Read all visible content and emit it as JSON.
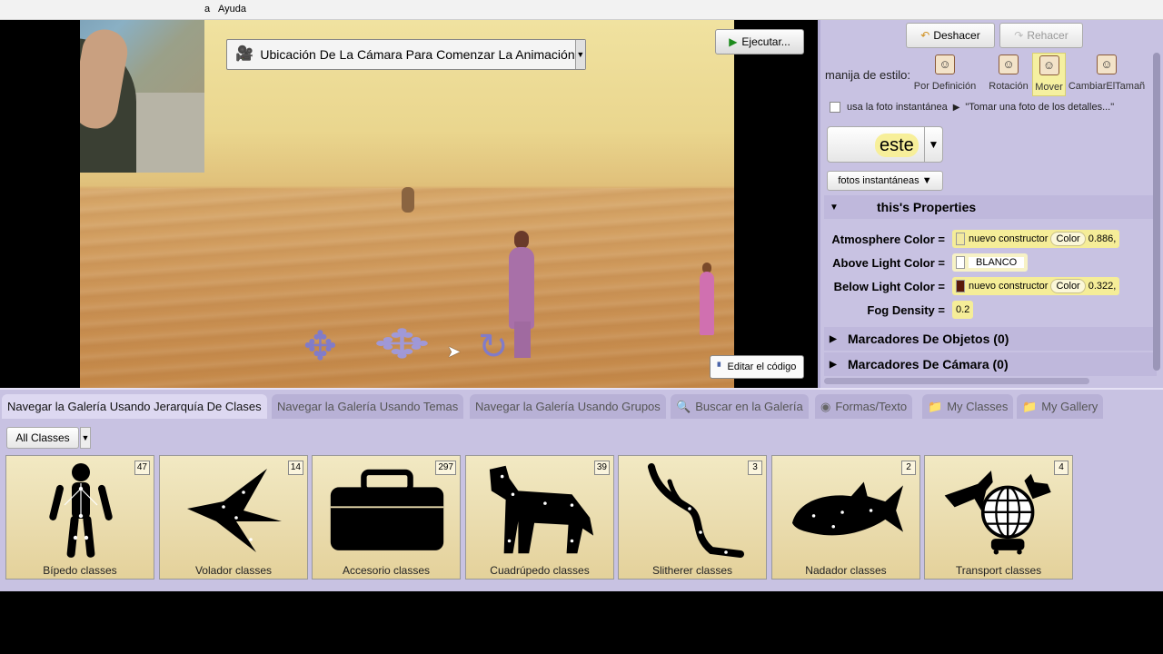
{
  "menu": {
    "partial_item": "a",
    "help": "Ayuda"
  },
  "scene": {
    "camera_marker_label": "Ubicación De La Cámara Para Comenzar La Animación",
    "run_button": "Ejecutar...",
    "edit_code_button": "Editar el código"
  },
  "toolbar": {
    "undo": "Deshacer",
    "redo": "Rehacer"
  },
  "handle_style": {
    "label": "manija de estilo:",
    "options": [
      {
        "label": "Por Definición",
        "icon": "default-style-icon"
      },
      {
        "label": "Rotación",
        "icon": "rotation-style-icon"
      },
      {
        "label": "Mover",
        "icon": "move-style-icon",
        "selected": true
      },
      {
        "label": "CambiarElTamañ",
        "icon": "resize-style-icon"
      }
    ]
  },
  "snapshot": {
    "checkbox_label": "usa la foto instantánea",
    "hint": "\"Tomar una foto de los detalles...\"",
    "menu_button": "fotos instantáneas ▼"
  },
  "selected_object": "este",
  "properties": {
    "header": "this's Properties",
    "rows": [
      {
        "name": "Atmosphere Color =",
        "ctor": "nuevo constructor",
        "kind": "Color",
        "value": "0.886,",
        "swatch": "#f2e9a0"
      },
      {
        "name": "Above Light Color =",
        "value": "BLANCO",
        "swatch": "#ffffff"
      },
      {
        "name": "Below Light Color =",
        "ctor": "nuevo constructor",
        "kind": "Color",
        "value": "0.322,",
        "swatch": "#5a1a0a"
      },
      {
        "name": "Fog Density =",
        "value": "0.2"
      }
    ],
    "object_markers": "Marcadores De Objetos (0)",
    "camera_markers": "Marcadores De Cámara (0)"
  },
  "gallery": {
    "tabs": [
      {
        "label": "Navegar la Galería Usando Jerarquía De Clases",
        "active": true
      },
      {
        "label": "Navegar la Galería Usando Temas"
      },
      {
        "label": "Navegar la Galería Usando Grupos"
      },
      {
        "label": "Buscar en la Galería",
        "icon": "search-icon"
      },
      {
        "label": "Formas/Texto",
        "icon": "shapes-icon"
      },
      {
        "label": "My Classes",
        "icon": "folder-icon"
      },
      {
        "label": "My Gallery",
        "icon": "folder-icon"
      }
    ],
    "class_filter": "All Classes",
    "cards": [
      {
        "label": "Bípedo classes",
        "count": "47",
        "icon": "biped-icon"
      },
      {
        "label": "Volador classes",
        "count": "14",
        "icon": "flyer-icon"
      },
      {
        "label": "Accesorio classes",
        "count": "297",
        "icon": "toolbox-icon"
      },
      {
        "label": "Cuadrúpedo classes",
        "count": "39",
        "icon": "quadruped-icon"
      },
      {
        "label": "Slitherer classes",
        "count": "3",
        "icon": "slitherer-icon"
      },
      {
        "label": "Nadador classes",
        "count": "2",
        "icon": "swimmer-icon"
      },
      {
        "label": "Transport classes",
        "count": "4",
        "icon": "transport-icon"
      }
    ]
  },
  "colors": {
    "panel": "#c8c2e2",
    "tile": "#eadcae",
    "tile_value": "#f5ed98",
    "sand": "#d29e60"
  }
}
